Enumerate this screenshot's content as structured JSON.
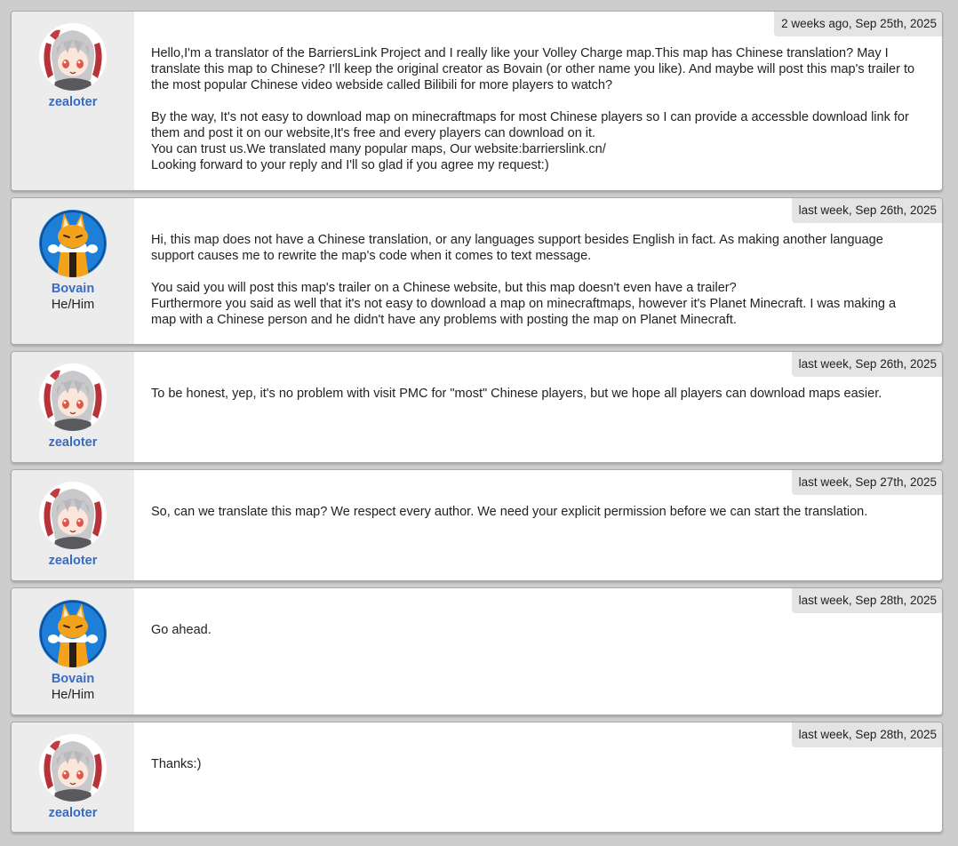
{
  "users": {
    "zealoter": {
      "name": "zealoter",
      "pronouns": ""
    },
    "bovain": {
      "name": "Bovain",
      "pronouns": "He/Him"
    }
  },
  "messages": [
    {
      "author": "zealoter",
      "timestamp": "2 weeks ago, Sep 25th, 2025",
      "text": "Hello,I'm a translator of the BarriersLink Project and I really like your Volley Charge map.This map has Chinese translation? May I translate this map to Chinese? I'll keep the original creator as Bovain (or other name you like). And maybe will post this map's trailer to the most popular Chinese video webside called Bilibili for more players to watch?\n\nBy the way, It's not easy to download map on minecraftmaps for most Chinese players so I can provide a accessble download link for them and post it on our website,It's free and every players can download on it.\nYou can trust us.We translated many popular maps, Our website:barrierslink.cn/\nLooking forward to your reply and I'll so glad if you agree my request:)"
    },
    {
      "author": "Bovain",
      "pronouns": "He/Him",
      "timestamp": "last week, Sep 26th, 2025",
      "text": "Hi, this map does not have a Chinese translation, or any languages support besides English in fact. As making another language support causes me to rewrite the map's code when it comes to text message.\n\nYou said you will post this map's trailer on a Chinese website, but this map doesn't even have a trailer?\nFurthermore you said as well that it's not easy to download a map on minecraftmaps, however it's Planet Minecraft. I was making a map with a Chinese person and he didn't have any problems with posting the map on Planet Minecraft."
    },
    {
      "author": "zealoter",
      "timestamp": "last week, Sep 26th, 2025",
      "text": "To be honest, yep, it's no problem with visit PMC for \"most\" Chinese players, but we hope all players can download maps easier."
    },
    {
      "author": "zealoter",
      "timestamp": "last week, Sep 27th, 2025",
      "text": "So, can we translate this map? We respect every author. We need your explicit permission before we can start the translation."
    },
    {
      "author": "Bovain",
      "pronouns": "He/Him",
      "timestamp": "last week, Sep 28th, 2025",
      "text": "Go ahead."
    },
    {
      "author": "zealoter",
      "timestamp": "last week, Sep 28th, 2025",
      "text": "Thanks:)"
    }
  ],
  "icons": {
    "zealoter_avatar": "anime-girl-avatar-icon",
    "bovain_avatar": "fox-avatar-icon"
  },
  "colors": {
    "background": "#cdcdcd",
    "username": "#3b6bbf",
    "author_panel": "#ececec",
    "timestamp_bg": "#e4e4e4",
    "bovain_avatar_bg": "#1e7fd8",
    "fox_orange": "#f5a21b"
  }
}
